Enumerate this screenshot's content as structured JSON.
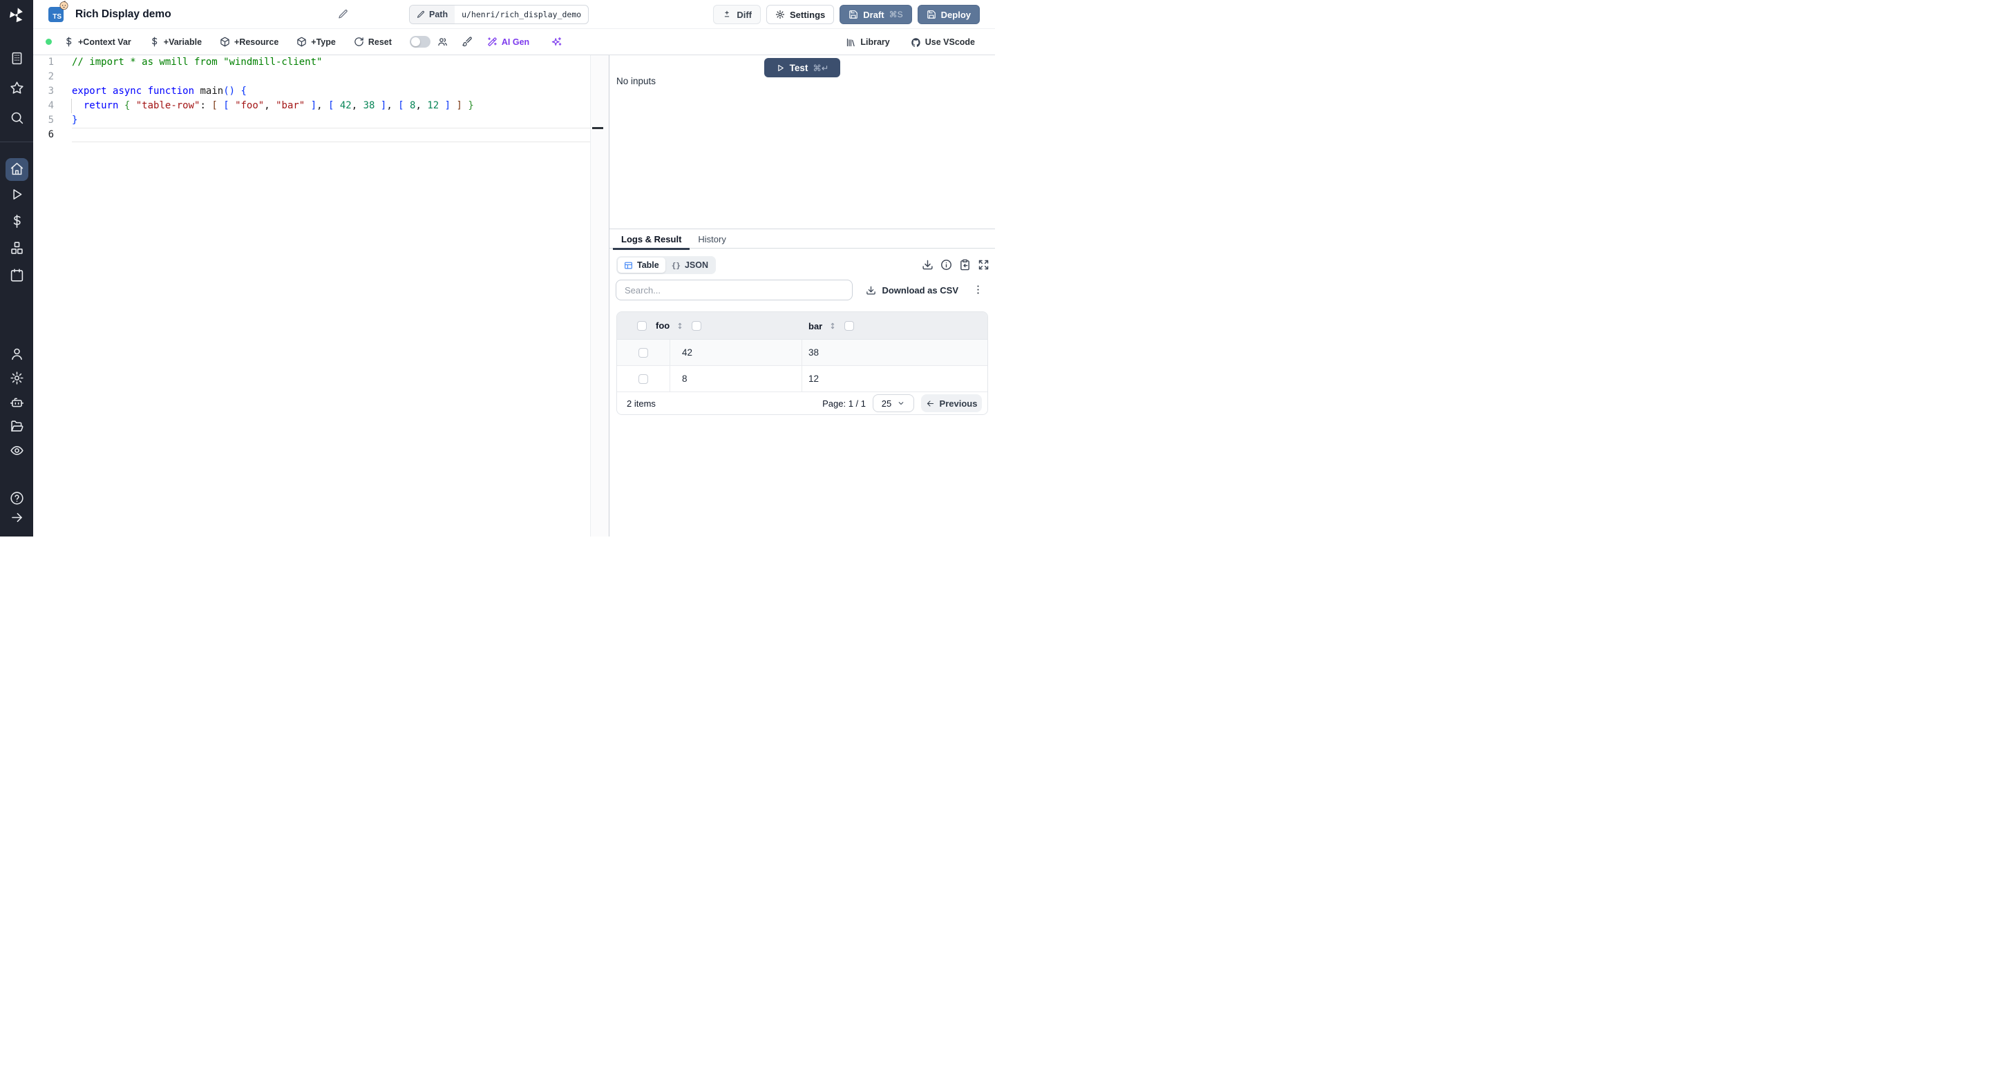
{
  "colors": {
    "sidebar_bg": "#1f232e",
    "accent_slate": "#5d7698",
    "test_button": "#3c4f6e",
    "ai_purple": "#7c3aed",
    "status_green": "#4ade80",
    "ts_badge_blue": "#3178c6",
    "table_icon_blue": "#3b82f6",
    "active_nav_bg": "#3e5374"
  },
  "sidebar": {
    "icons": [
      "windmill-logo",
      "building",
      "star",
      "search",
      "home",
      "play",
      "dollar",
      "boxes",
      "calendar",
      "user",
      "gear",
      "bot",
      "folder-open",
      "eye",
      "help-circle",
      "arrow-right"
    ],
    "active_item": "home"
  },
  "header": {
    "lang_badge": "TS",
    "title": "Rich Display demo",
    "path_label": "Path",
    "path_value": "u/henri/rich_display_demo",
    "diff_label": "Diff",
    "settings_label": "Settings",
    "draft_label": "Draft",
    "draft_shortcut": "⌘S",
    "deploy_label": "Deploy"
  },
  "toolbar": {
    "context_var": "+Context Var",
    "variable": "+Variable",
    "resource": "+Resource",
    "type": "+Type",
    "reset": "Reset",
    "ai_gen": "AI Gen",
    "library": "Library",
    "vscode": "Use VScode"
  },
  "editor": {
    "active_line": 6,
    "lines": [
      [
        {
          "t": "// import * as wmill from \"windmill-client\"",
          "c": "comment"
        }
      ],
      [],
      [
        {
          "t": "export",
          "c": "kw"
        },
        {
          "t": " ",
          "c": "plain"
        },
        {
          "t": "async",
          "c": "kw"
        },
        {
          "t": " ",
          "c": "plain"
        },
        {
          "t": "function",
          "c": "kw"
        },
        {
          "t": " ",
          "c": "plain"
        },
        {
          "t": "main",
          "c": "fn"
        },
        {
          "t": "()",
          "c": "b1"
        },
        {
          "t": " ",
          "c": "plain"
        },
        {
          "t": "{",
          "c": "b1"
        }
      ],
      [
        {
          "t": "  ",
          "c": "plain"
        },
        {
          "t": "return",
          "c": "kw"
        },
        {
          "t": " ",
          "c": "plain"
        },
        {
          "t": "{",
          "c": "b2"
        },
        {
          "t": " ",
          "c": "plain"
        },
        {
          "t": "\"table-row\"",
          "c": "str"
        },
        {
          "t": ": ",
          "c": "plain"
        },
        {
          "t": "[",
          "c": "b3"
        },
        {
          "t": " ",
          "c": "plain"
        },
        {
          "t": "[",
          "c": "b1"
        },
        {
          "t": " ",
          "c": "plain"
        },
        {
          "t": "\"foo\"",
          "c": "str"
        },
        {
          "t": ", ",
          "c": "plain"
        },
        {
          "t": "\"bar\"",
          "c": "str"
        },
        {
          "t": " ",
          "c": "plain"
        },
        {
          "t": "]",
          "c": "b1"
        },
        {
          "t": ", ",
          "c": "plain"
        },
        {
          "t": "[",
          "c": "b1"
        },
        {
          "t": " ",
          "c": "plain"
        },
        {
          "t": "42",
          "c": "num"
        },
        {
          "t": ", ",
          "c": "plain"
        },
        {
          "t": "38",
          "c": "num"
        },
        {
          "t": " ",
          "c": "plain"
        },
        {
          "t": "]",
          "c": "b1"
        },
        {
          "t": ", ",
          "c": "plain"
        },
        {
          "t": "[",
          "c": "b1"
        },
        {
          "t": " ",
          "c": "plain"
        },
        {
          "t": "8",
          "c": "num"
        },
        {
          "t": ", ",
          "c": "plain"
        },
        {
          "t": "12",
          "c": "num"
        },
        {
          "t": " ",
          "c": "plain"
        },
        {
          "t": "]",
          "c": "b1"
        },
        {
          "t": " ",
          "c": "plain"
        },
        {
          "t": "]",
          "c": "b3"
        },
        {
          "t": " ",
          "c": "plain"
        },
        {
          "t": "}",
          "c": "b2"
        }
      ],
      [
        {
          "t": "}",
          "c": "b1"
        }
      ],
      []
    ]
  },
  "run_panel": {
    "test_label": "Test",
    "test_shortcut": "⌘↵",
    "no_inputs": "No inputs"
  },
  "result_panel": {
    "tabs": {
      "logs": "Logs & Result",
      "history": "History"
    },
    "view_toggle": {
      "table": "Table",
      "json": "JSON",
      "json_icon": "{}"
    },
    "search_placeholder": "Search...",
    "download_csv": "Download as CSV",
    "table": {
      "columns": [
        "foo",
        "bar"
      ],
      "rows": [
        [
          "42",
          "38"
        ],
        [
          "8",
          "12"
        ]
      ],
      "items_label": "2 items",
      "page_label": "Page: 1 / 1",
      "page_size": "25",
      "previous_label": "Previous"
    }
  }
}
